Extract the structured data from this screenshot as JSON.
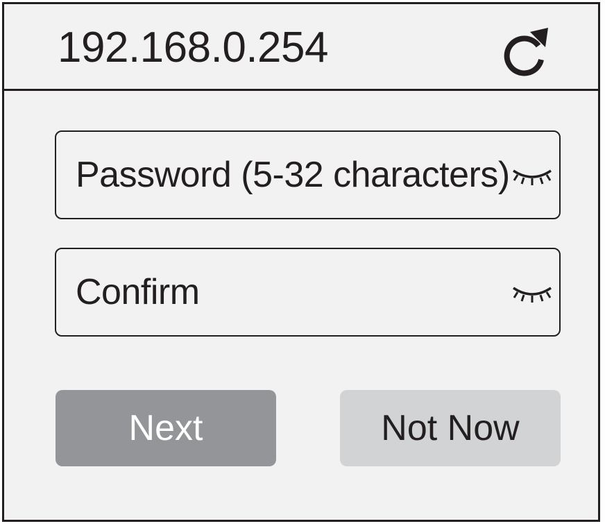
{
  "address_bar": {
    "url": "192.168.0.254",
    "refresh_icon": "refresh-icon"
  },
  "form": {
    "password_field": {
      "placeholder": "Password (5-32 characters)",
      "value": "",
      "visibility_icon": "eye-closed-icon"
    },
    "confirm_field": {
      "placeholder": "Confirm",
      "value": "",
      "visibility_icon": "eye-closed-icon"
    }
  },
  "buttons": {
    "next_label": "Next",
    "not_now_label": "Not Now"
  },
  "colors": {
    "background": "#f2f2f2",
    "border": "#231f20",
    "next_button": "#939598",
    "not_now_button": "#d1d3d4"
  }
}
